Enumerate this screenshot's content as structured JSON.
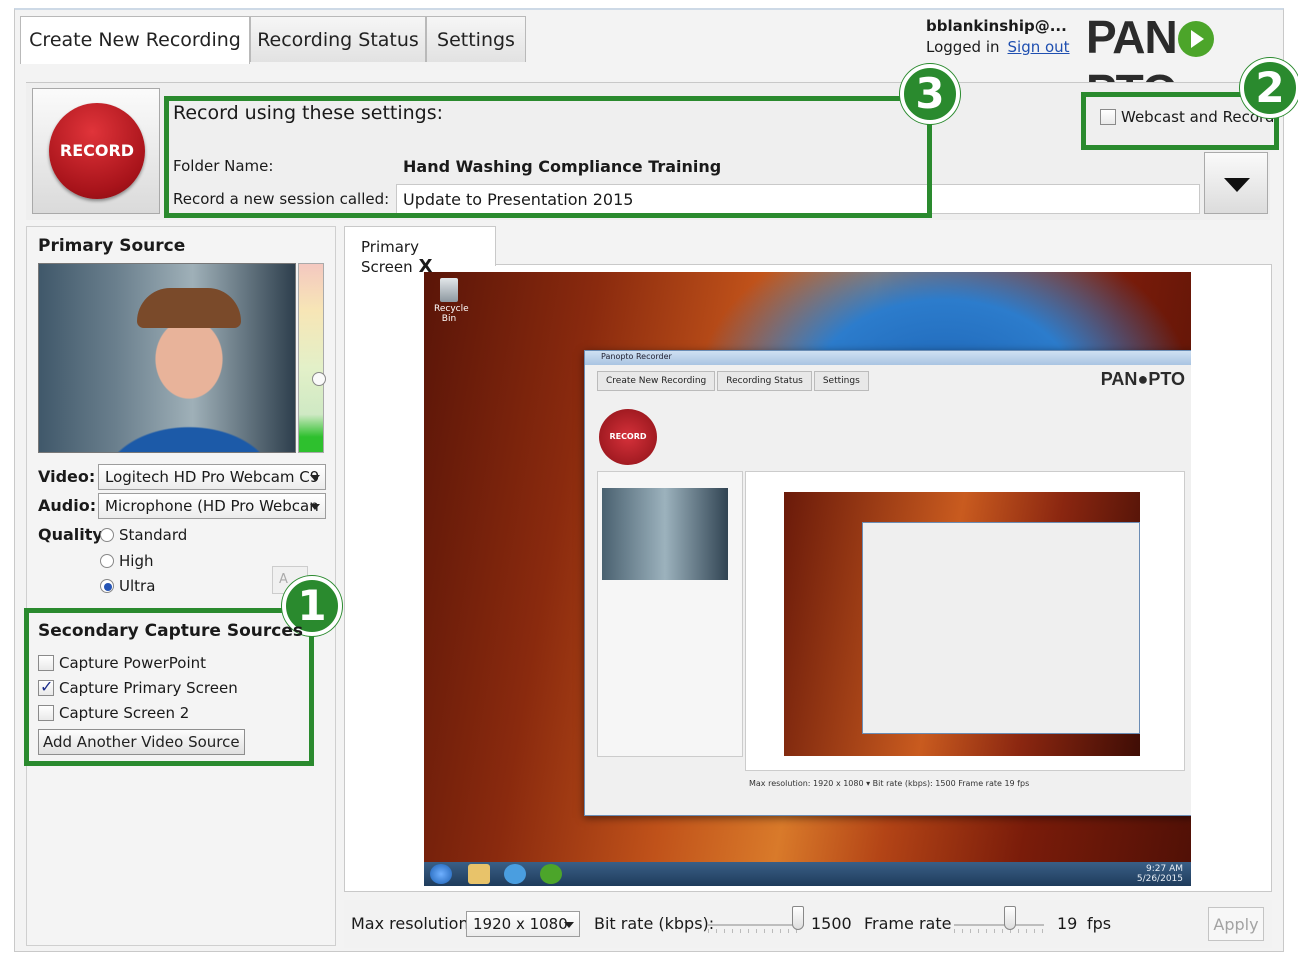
{
  "tabs": [
    {
      "label": "Create New Recording",
      "active": true
    },
    {
      "label": "Recording Status",
      "active": false
    },
    {
      "label": "Settings",
      "active": false
    }
  ],
  "user": {
    "name": "bblankinship@...",
    "logged_in": "Logged in",
    "sign_out": "Sign out"
  },
  "brand": {
    "left": "PAN",
    "right": "PTO"
  },
  "record": {
    "label": "RECORD"
  },
  "settings": {
    "heading": "Record using these settings:",
    "folder_label": "Folder Name:",
    "folder_value": "Hand Washing Compliance Training",
    "session_label": "Record a new session called:",
    "session_value": "Update to Presentation 2015",
    "webcast_label": "Webcast and Record",
    "webcast_checked": false
  },
  "callouts": [
    "1",
    "2",
    "3"
  ],
  "primary_source": {
    "title": "Primary Source",
    "video_label": "Video:",
    "video_value": "Logitech HD Pro Webcam C9",
    "audio_label": "Audio:",
    "audio_value": "Microphone (HD Pro Webcan",
    "quality_label": "Quality:",
    "quality_options": [
      "Standard",
      "High",
      "Ultra"
    ],
    "quality_selected": "Ultra",
    "apply_ghost": "A"
  },
  "secondary": {
    "title": "Secondary Capture Sources",
    "items": [
      {
        "label": "Capture PowerPoint",
        "checked": false
      },
      {
        "label": "Capture Primary Screen",
        "checked": true
      },
      {
        "label": "Capture Screen 2",
        "checked": false
      }
    ],
    "add_button": "Add Another Video Source"
  },
  "preview_tab": {
    "label": "Primary Screen",
    "close": "X"
  },
  "desktop": {
    "recycle_label": "Recycle Bin",
    "clock_time": "9:27 AM",
    "clock_date": "5/26/2015",
    "nested_title": "Panopto Recorder",
    "nested_tabs": [
      "Create New Recording",
      "Recording Status",
      "Settings"
    ],
    "nested_footer": "Max resolution: 1920 x 1080 ▾   Bit rate (kbps): 1500   Frame rate 19 fps"
  },
  "footer": {
    "max_res_label": "Max resolution:",
    "max_res_value": "1920 x 1080",
    "bitrate_label": "Bit rate (kbps):",
    "bitrate_value": "1500",
    "framerate_label": "Frame rate",
    "framerate_value": "19",
    "fps_label": "fps",
    "apply_label": "Apply"
  },
  "colors": {
    "callout_green": "#2a8a2e",
    "record_red": "#b5161d",
    "link_blue": "#1f4fb0"
  }
}
